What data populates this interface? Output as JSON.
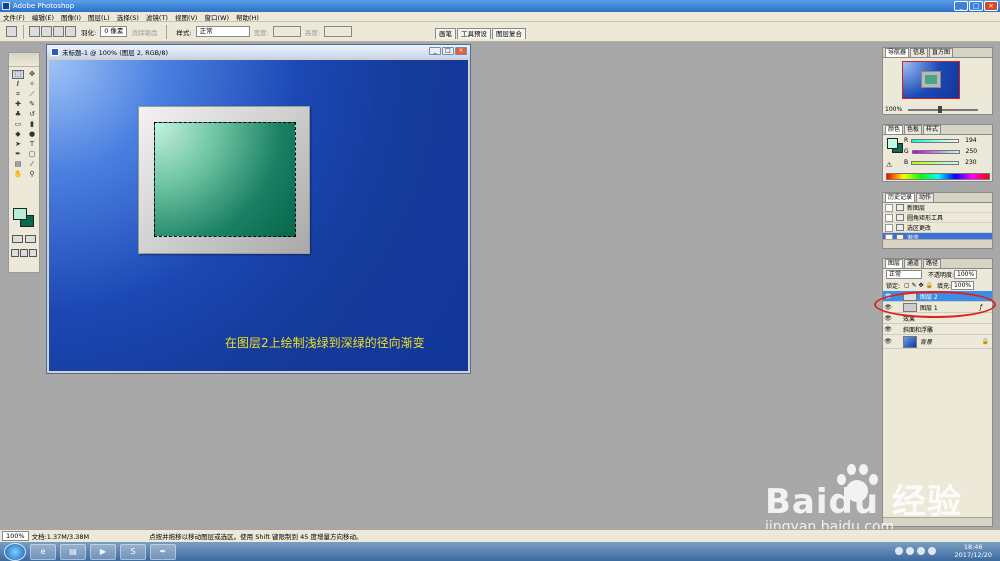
{
  "app": {
    "title": "Adobe Photoshop"
  },
  "menu": [
    "文件(F)",
    "编辑(E)",
    "图像(I)",
    "图层(L)",
    "选择(S)",
    "滤镜(T)",
    "视图(V)",
    "窗口(W)",
    "帮助(H)"
  ],
  "options": {
    "feather_label": "羽化:",
    "feather_value": "0 像素",
    "antialias_label": "消除锯齿",
    "style_label": "样式:",
    "style_value": "正常",
    "width_label": "宽度:",
    "height_label": "高度:"
  },
  "palette_well": [
    "画笔",
    "工具预设",
    "图层复合"
  ],
  "document": {
    "title": "未标题-1 @ 100% (图层 2, RGB/8)",
    "caption": "在图层2上绘制浅绿到深绿的径向渐变"
  },
  "navigator": {
    "tabs": [
      "导航器",
      "信息",
      "直方图"
    ],
    "zoom": "100%"
  },
  "color_panel": {
    "tabs": [
      "颜色",
      "色板",
      "样式"
    ],
    "r_label": "R",
    "r_value": "194",
    "g_label": "G",
    "g_value": "250",
    "b_label": "B",
    "b_value": "230",
    "fg_color": "#c2fae6",
    "bg_color": "#0e6a4e"
  },
  "history": {
    "tabs": [
      "历史记录",
      "动作"
    ],
    "items": [
      "新图层",
      "圆角矩形工具",
      "选区更改",
      "渐变"
    ],
    "selected_index": 3
  },
  "layers": {
    "tabs": [
      "图层",
      "通道",
      "路径"
    ],
    "blend_mode": "正常",
    "opacity_label": "不透明度:",
    "opacity_value": "100%",
    "lock_label": "锁定:",
    "fill_label": "填充:",
    "fill_value": "100%",
    "rows": [
      "图层 2",
      "图层 1",
      "效果",
      "斜面和浮雕",
      "背景"
    ],
    "selected": "图层 2"
  },
  "status": {
    "zoom": "100%",
    "doc_info": "文档:1.37M/3.38M",
    "hint": "点按并拖移以移动图层或选区。使用 Shift 键限制到 45 度增量方向移动。"
  },
  "taskbar": {
    "time": "18:46",
    "date": "2017/12/20"
  },
  "watermark": {
    "brand": "Baidu 经验",
    "url": "jingyan.baidu.com"
  },
  "colors": {
    "canvas_blue": "#1c48b4",
    "caption_yellow": "#f0e020",
    "selection_blue": "#3a8ee8",
    "annotation_red": "#e02020"
  }
}
